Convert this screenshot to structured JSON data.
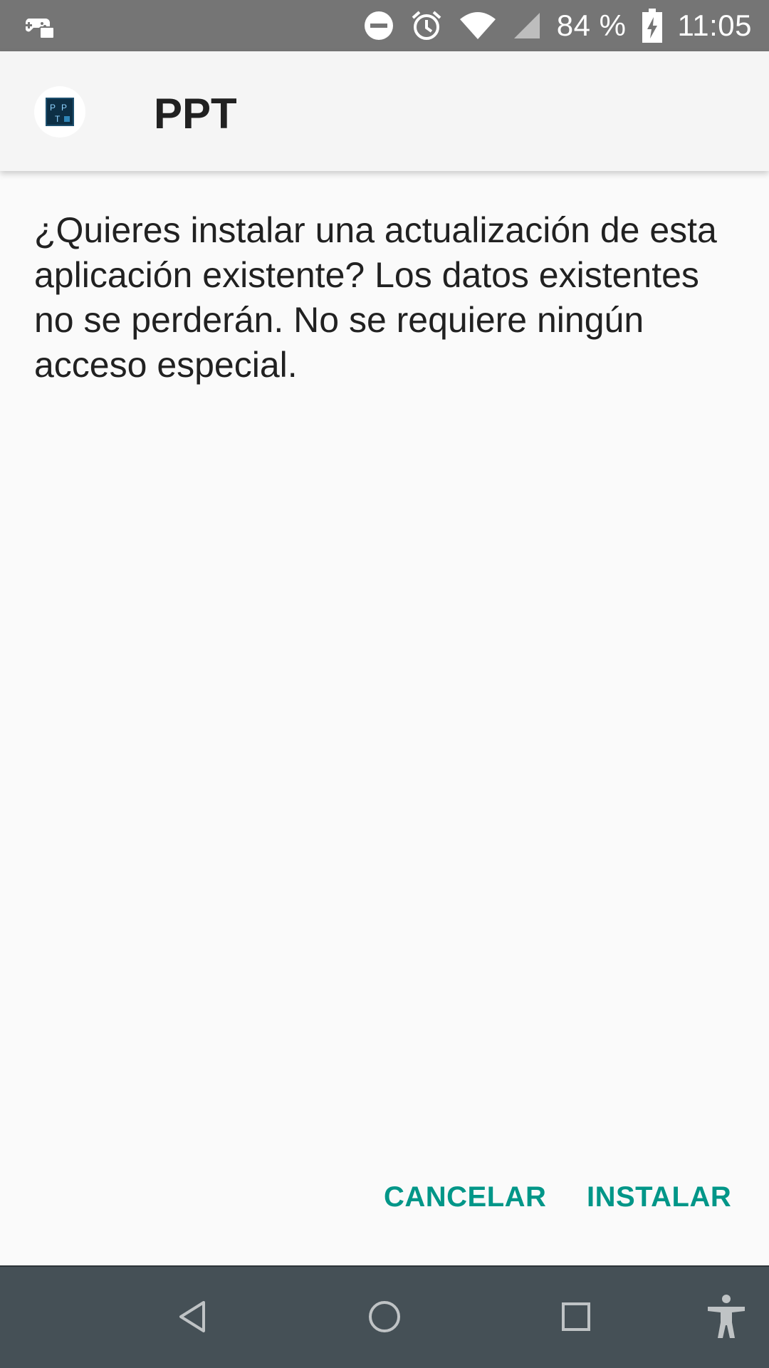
{
  "status_bar": {
    "battery_percent": "84 %",
    "time": "11:05",
    "icons": [
      "game-controller-icon",
      "do-not-disturb-icon",
      "alarm-icon",
      "wifi-icon",
      "cell-signal-icon",
      "battery-charging-icon"
    ]
  },
  "app_bar": {
    "app_name": "PPT",
    "icon": "ppt-app-icon"
  },
  "dialog": {
    "message": "¿Quieres instalar una actualización de esta aplicación existente? Los datos existentes no se perderán. No se requiere ningún acceso especial."
  },
  "actions": {
    "cancel_label": "CANCELAR",
    "install_label": "INSTALAR"
  },
  "nav_bar": {
    "icons": [
      "back-icon",
      "home-icon",
      "recents-icon",
      "accessibility-icon"
    ]
  },
  "colors": {
    "accent": "#009688",
    "status_bar": "#757575",
    "nav_bar": "#455056",
    "app_bar": "#f5f5f5",
    "background": "#fafafa"
  }
}
